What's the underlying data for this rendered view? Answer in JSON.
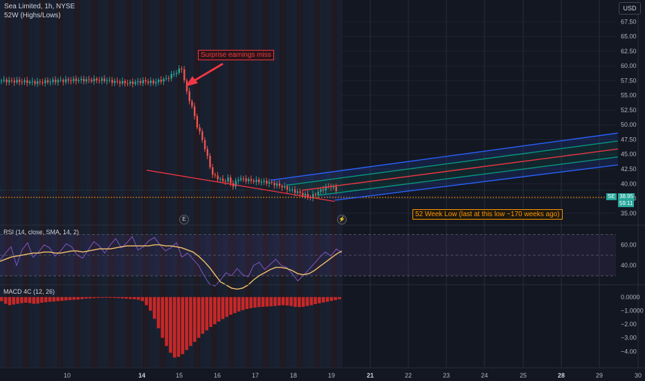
{
  "header": {
    "symbol_line": "Sea Limited, 1h, NYSE",
    "indicator_line": "52W (Highs/Lows)",
    "currency": "USD"
  },
  "colors": {
    "background": "#131722",
    "candle_up": "#26a69a",
    "candle_down": "#ef5350",
    "channel_outer": "#2962ff",
    "channel_inner": "#089981",
    "channel_mid": "#f23645",
    "annotation_red": "#f23645",
    "low_line": "#ff9800",
    "rsi_line": "#7e57c2",
    "rsi_sma": "#f7c56b",
    "macd_bar": "#c62828"
  },
  "annotations": {
    "earnings": "Surprise earnings miss",
    "low_label": "52 Week Low (last at this low ~170 weeks ago)",
    "earnings_marker": "E",
    "dividend_marker": "⚡"
  },
  "price_tags": {
    "last_symbol": "SE",
    "last_price": "38.95",
    "countdown": "59:11"
  },
  "chart_data": [
    {
      "type": "candlestick",
      "pane": "price",
      "title": "Sea Limited, 1h, NYSE",
      "x_ticks": [
        "10",
        "14",
        "15",
        "16",
        "17",
        "18",
        "19",
        "21",
        "22",
        "23",
        "24",
        "25",
        "28",
        "29",
        "30"
      ],
      "y_ticks": [
        "35.00",
        "37.50",
        "40.00",
        "42.50",
        "45.00",
        "47.50",
        "50.00",
        "52.50",
        "55.00",
        "57.50",
        "60.00",
        "62.50",
        "65.00",
        "67.50"
      ],
      "ylim": [
        33.8,
        68.6
      ],
      "close_path": [
        [
          0,
          57.5
        ],
        [
          6,
          57.4
        ],
        [
          14,
          57.2
        ],
        [
          22,
          57.5
        ],
        [
          30,
          57.6
        ],
        [
          40,
          57.6
        ],
        [
          44,
          57.3
        ],
        [
          50,
          57.1
        ],
        [
          55,
          57.4
        ],
        [
          59,
          57.2
        ],
        [
          64,
          57.8
        ],
        [
          70,
          59.6
        ],
        [
          72,
          55.5
        ],
        [
          74,
          53.0
        ],
        [
          76,
          49.8
        ],
        [
          78,
          47.5
        ],
        [
          80,
          44.5
        ],
        [
          82,
          41.5
        ],
        [
          84,
          41.0
        ],
        [
          86,
          40.4
        ],
        [
          88,
          40.8
        ],
        [
          90,
          39.6
        ],
        [
          92,
          40.9
        ],
        [
          96,
          40.6
        ],
        [
          100,
          40.4
        ],
        [
          104,
          40.2
        ],
        [
          108,
          39.7
        ],
        [
          112,
          39.0
        ],
        [
          116,
          38.4
        ],
        [
          120,
          37.7
        ],
        [
          124,
          38.9
        ],
        [
          126,
          39.4
        ],
        [
          128,
          39.6
        ],
        [
          130,
          38.9
        ]
      ],
      "low_level": 37.7,
      "last_price": 38.95,
      "channel": {
        "start": [
          105,
          40.6
        ],
        "end": [
          240,
          48.6
        ],
        "end_bottom": [
          240,
          43.2
        ],
        "anchor_low": [
          130,
          37.2
        ],
        "levels": [
          1.0,
          0.75,
          0.5,
          0.25,
          0.0
        ]
      },
      "trend_line": {
        "from": [
          57,
          42.3
        ],
        "to": [
          130,
          37.0
        ]
      }
    },
    {
      "type": "line",
      "pane": "rsi",
      "title": "RSI (14, close, SMA, 14, 2)",
      "y_ticks": [
        "40.00",
        "60.00"
      ],
      "bands": [
        30,
        50,
        70
      ],
      "ylim": [
        26,
        73
      ],
      "series": [
        {
          "name": "RSI",
          "values": [
            45,
            52,
            58,
            40,
            55,
            62,
            48,
            53,
            60,
            57,
            49,
            54,
            61,
            58,
            50,
            47,
            55,
            63,
            59,
            52,
            60,
            66,
            57,
            62,
            68,
            55,
            58,
            64,
            67,
            60,
            54,
            57,
            62,
            48,
            52,
            46,
            40,
            30,
            22,
            20,
            26,
            33,
            30,
            37,
            31,
            29,
            40,
            43,
            36,
            41,
            46,
            40,
            38,
            32,
            25,
            30,
            36,
            42,
            48,
            53,
            49,
            56,
            52
          ]
        },
        {
          "name": "SMA",
          "values": [
            44,
            46,
            48,
            49,
            50,
            51,
            52,
            52,
            53,
            53,
            52,
            52,
            53,
            54,
            54,
            53,
            54,
            55,
            56,
            56,
            56,
            57,
            58,
            59,
            59,
            59,
            59,
            59,
            60,
            60,
            59,
            59,
            58,
            57,
            55,
            53,
            49,
            44,
            38,
            31,
            24,
            21,
            18,
            17,
            18,
            21,
            26,
            30,
            33,
            36,
            38,
            38,
            37,
            35,
            32,
            31,
            32,
            35,
            39,
            43,
            47,
            51,
            54
          ]
        }
      ]
    },
    {
      "type": "bar",
      "pane": "macd",
      "title": "MACD 4C (12, 26)",
      "y_ticks": [
        "0.0000",
        "−1.0000",
        "−2.00",
        "−3.00",
        "−4.00"
      ],
      "ylim": [
        -4.75,
        0.55
      ],
      "values": [
        -0.3,
        -0.5,
        -0.6,
        -0.55,
        -0.5,
        -0.45,
        -0.42,
        -0.45,
        -0.5,
        -0.48,
        -0.42,
        -0.38,
        -0.35,
        -0.33,
        -0.3,
        -0.28,
        -0.25,
        -0.22,
        -0.2,
        -0.18,
        -0.15,
        -0.12,
        -0.1,
        -0.08,
        -0.06,
        -0.05,
        -0.05,
        -0.06,
        -0.07,
        -0.08,
        -0.1,
        -0.12,
        -0.14,
        -0.16,
        -0.2,
        -0.3,
        -0.6,
        -1.0,
        -1.6,
        -2.3,
        -3.0,
        -3.6,
        -4.1,
        -4.45,
        -4.4,
        -4.2,
        -3.9,
        -3.6,
        -3.3,
        -3.0,
        -2.7,
        -2.45,
        -2.2,
        -2.0,
        -1.8,
        -1.62,
        -1.46,
        -1.3,
        -1.18,
        -1.06,
        -0.96,
        -0.88,
        -0.82,
        -0.78,
        -0.74,
        -0.72,
        -0.7,
        -0.68,
        -0.66,
        -0.62,
        -0.6,
        -0.62,
        -0.66,
        -0.72,
        -0.74,
        -0.72,
        -0.66,
        -0.6,
        -0.52,
        -0.46,
        -0.4,
        -0.34,
        -0.28,
        -0.22,
        -0.16
      ]
    }
  ]
}
